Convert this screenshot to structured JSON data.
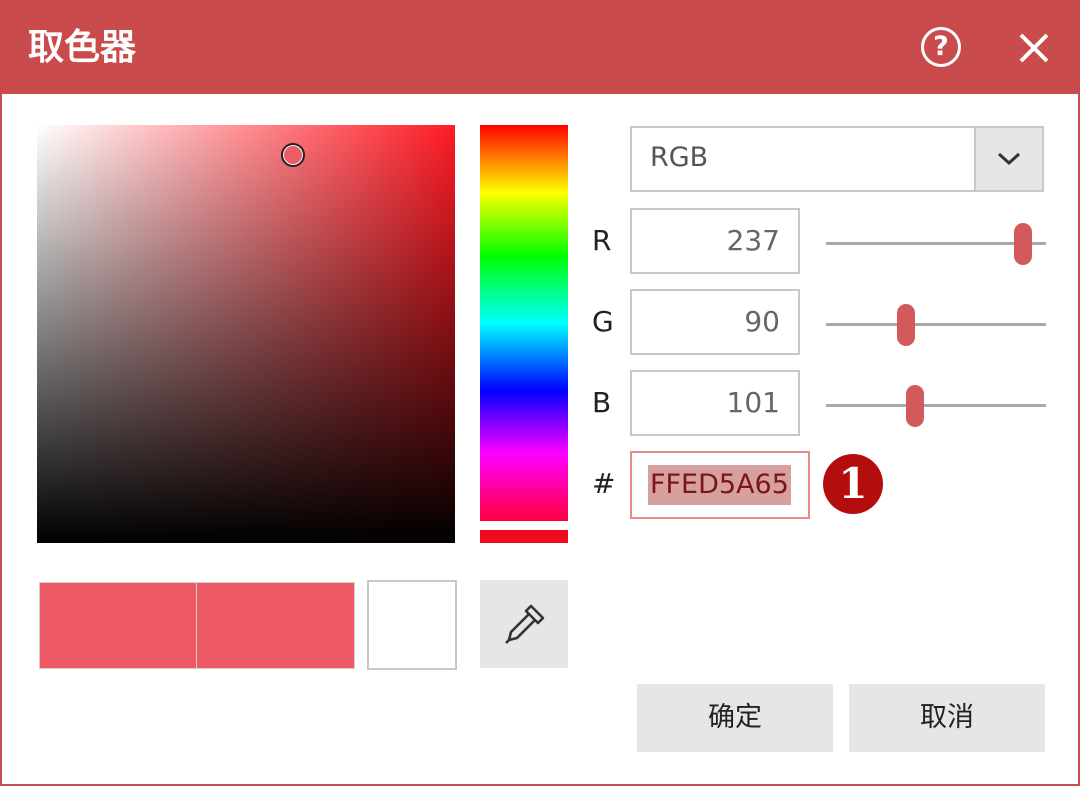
{
  "dialog": {
    "title": "取色器",
    "help_symbol": "?",
    "accent_color": "#c94b4b"
  },
  "picker": {
    "current_color": "#ED5A65",
    "previous_color": "#FFFFFF"
  },
  "mode": {
    "selected": "RGB"
  },
  "channels": {
    "r": {
      "label": "R",
      "value": "237",
      "level": 237
    },
    "g": {
      "label": "G",
      "value": "90",
      "level": 90
    },
    "b": {
      "label": "B",
      "value": "101",
      "level": 101
    }
  },
  "hex": {
    "label": "#",
    "value": "FFED5A65"
  },
  "badge": {
    "text": "1"
  },
  "buttons": {
    "ok": "确定",
    "cancel": "取消"
  },
  "icons": {
    "help": "help-icon",
    "close": "close-icon",
    "eyedropper": "eyedropper-icon",
    "dropdown": "chevron-down-icon"
  }
}
